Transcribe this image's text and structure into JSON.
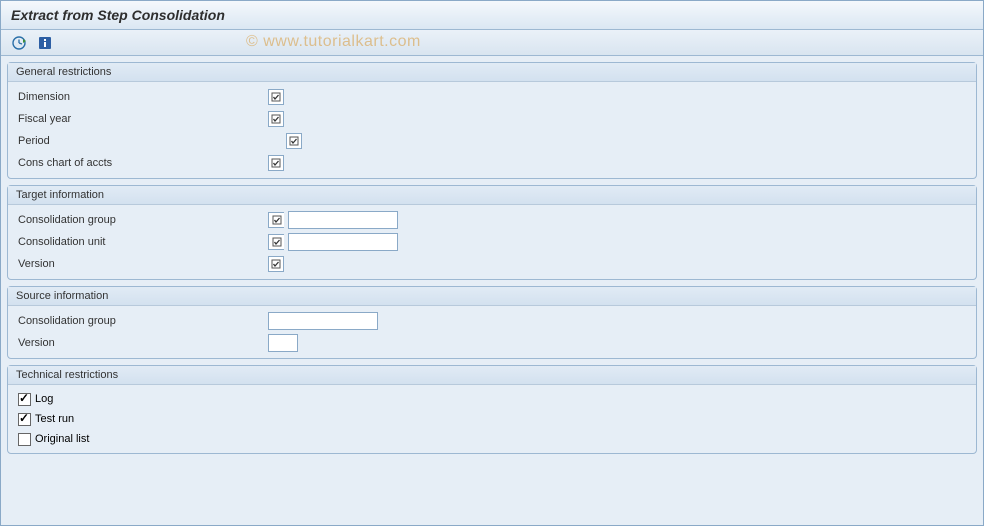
{
  "window": {
    "title": "Extract from Step Consolidation"
  },
  "toolbar": {
    "execute_tooltip": "Execute",
    "info_tooltip": "Information"
  },
  "groups": {
    "general": {
      "title": "General restrictions",
      "dimension_label": "Dimension",
      "dimension_value": "",
      "fiscal_year_label": "Fiscal year",
      "fiscal_year_value": "",
      "period_label": "Period",
      "period_value": "",
      "cons_chart_label": "Cons chart of accts",
      "cons_chart_value": ""
    },
    "target": {
      "title": "Target information",
      "cons_group_label": "Consolidation group",
      "cons_group_value": "",
      "cons_unit_label": "Consolidation unit",
      "cons_unit_value": "",
      "version_label": "Version",
      "version_value": ""
    },
    "source": {
      "title": "Source information",
      "cons_group_label": "Consolidation group",
      "cons_group_value": "",
      "version_label": "Version",
      "version_value": ""
    },
    "technical": {
      "title": "Technical restrictions",
      "log_label": "Log",
      "log_checked": true,
      "test_run_label": "Test run",
      "test_run_checked": true,
      "original_list_label": "Original list",
      "original_list_checked": false
    }
  },
  "watermark": "© www.tutorialkart.com"
}
